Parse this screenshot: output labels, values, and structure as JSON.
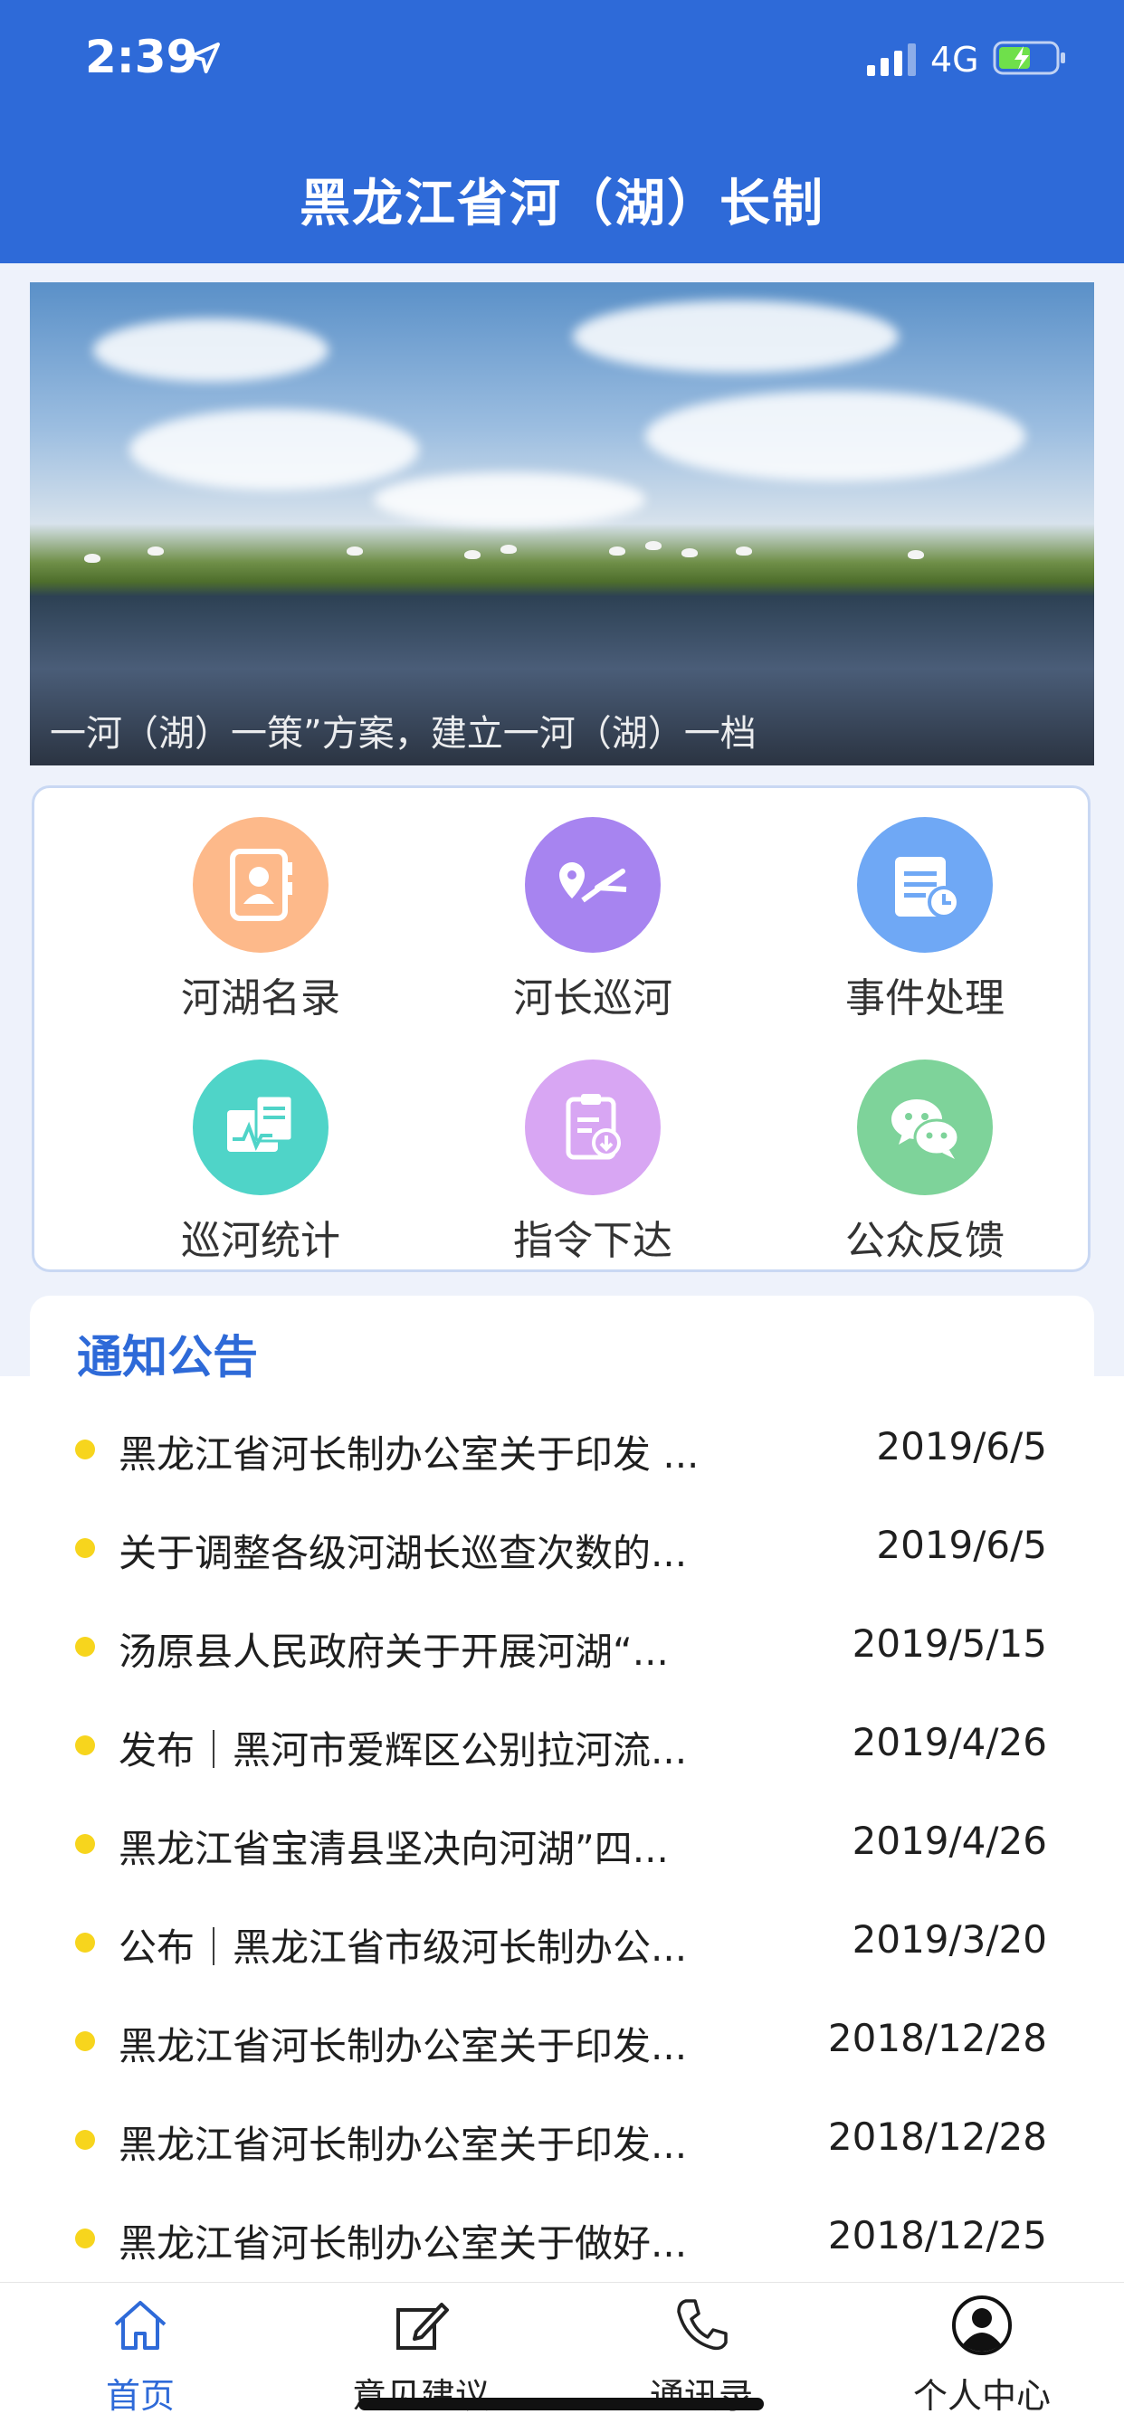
{
  "status": {
    "time": "2:39",
    "network": "4G"
  },
  "header": {
    "title": "黑龙江省河（湖）长制"
  },
  "banner": {
    "caption": "一河（湖）一策”方案，建立一河（湖）一档"
  },
  "menu": [
    {
      "label": "河湖名录",
      "icon": "contacts-icon",
      "color": "#fdb98a"
    },
    {
      "label": "河长巡河",
      "icon": "route-icon",
      "color": "#a784f0"
    },
    {
      "label": "事件处理",
      "icon": "event-icon",
      "color": "#6fa8f5"
    },
    {
      "label": "巡河统计",
      "icon": "statistics-icon",
      "color": "#4fd4c8"
    },
    {
      "label": "指令下达",
      "icon": "instruction-icon",
      "color": "#d8a6f3"
    },
    {
      "label": "公众反馈",
      "icon": "wechat-icon",
      "color": "#7ed39a"
    }
  ],
  "notices": {
    "title": "通知公告",
    "items": [
      {
        "text": "黑龙江省河长制办公室关于印发 ...",
        "date": "2019/6/5"
      },
      {
        "text": "关于调整各级河湖长巡查次数的...",
        "date": "2019/6/5"
      },
      {
        "text": "汤原县人民政府关于开展河湖“...",
        "date": "2019/5/15"
      },
      {
        "text": "发布｜黑河市爱辉区公别拉河流...",
        "date": "2019/4/26"
      },
      {
        "text": "黑龙江省宝清县坚决向河湖”四...",
        "date": "2019/4/26"
      },
      {
        "text": "公布｜黑龙江省市级河长制办公...",
        "date": "2019/3/20"
      },
      {
        "text": "黑龙江省河长制办公室关于印发...",
        "date": "2018/12/28"
      },
      {
        "text": "黑龙江省河长制办公室关于印发...",
        "date": "2018/12/28"
      },
      {
        "text": "黑龙江省河长制办公室关于做好...",
        "date": "2018/12/25"
      }
    ]
  },
  "tabbar": [
    {
      "label": "首页",
      "icon": "home-icon",
      "active": true
    },
    {
      "label": "意见建议",
      "icon": "edit-icon",
      "active": false
    },
    {
      "label": "通讯录",
      "icon": "phone-icon",
      "active": false
    },
    {
      "label": "个人中心",
      "icon": "user-icon",
      "active": false
    }
  ],
  "colors": {
    "primary": "#2e6ad8",
    "dot": "#f7d51d"
  }
}
